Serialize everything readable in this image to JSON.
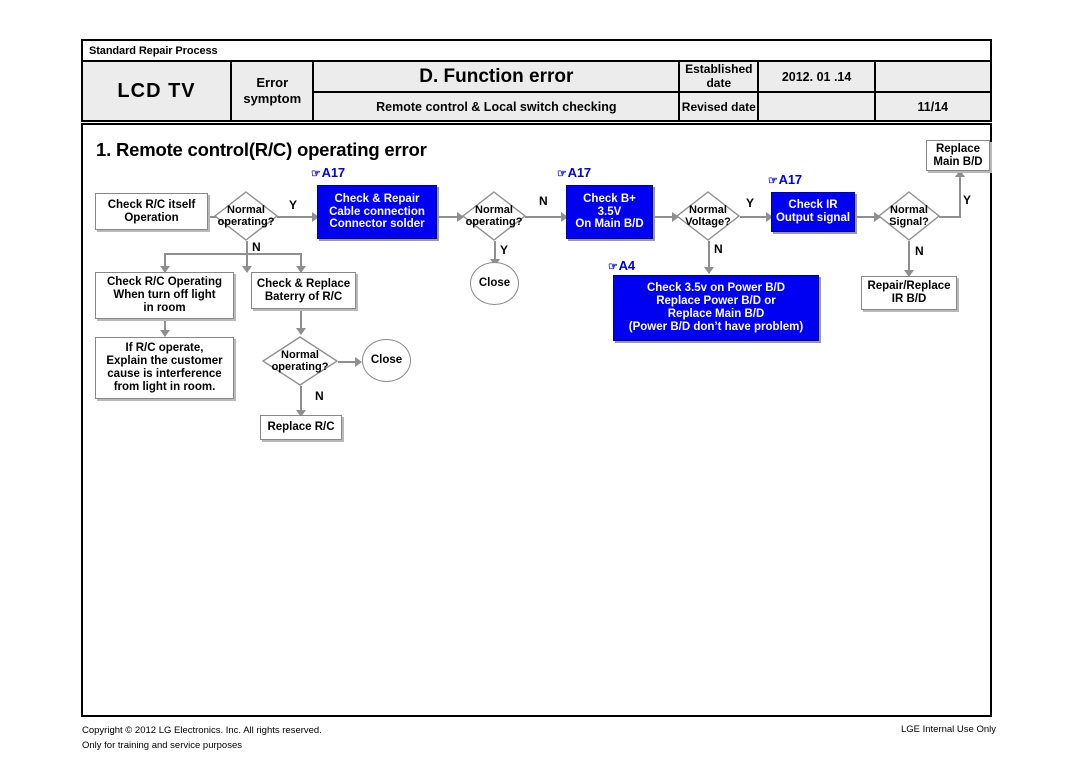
{
  "header": {
    "standard_process": "Standard Repair Process",
    "product": "LCD  TV",
    "error_symptom": "Error\nsymptom",
    "error_symptom_line1": "Error",
    "error_symptom_line2": "symptom",
    "title": "D. Function error",
    "subtitle": "Remote control & Local switch checking",
    "established_label_line1": "Established",
    "established_label_line2": "date",
    "revised_label": "Revised date",
    "established_date": "2012. 01 .14",
    "revised_date": "",
    "blank_cell": "",
    "page_number": "11/14"
  },
  "section": {
    "title": "1. Remote control(R/C) operating error"
  },
  "flow": {
    "tags": {
      "a17_1": "A17",
      "a17_2": "A17",
      "a17_3": "A17",
      "a4": "A4",
      "hand_glyph": "☞"
    },
    "nodes": {
      "check_rc_itself": "Check R/C itself\nOperation",
      "check_rc_itself_l1": "Check R/C itself",
      "check_rc_itself_l2": "Operation",
      "d_normal_operating_1_l1": "Normal",
      "d_normal_operating_1_l2": "operating?",
      "check_repair_cable_l1": "Check & Repair",
      "check_repair_cable_l2": "Cable connection",
      "check_repair_cable_l3": "Connector solder",
      "d_normal_operating_2_l1": "Normal",
      "d_normal_operating_2_l2": "operating?",
      "close_1": "Close",
      "check_bplus_l1": "Check B+",
      "check_bplus_l2": "3.5V",
      "check_bplus_l3": "On Main B/D",
      "d_normal_voltage_l1": "Normal",
      "d_normal_voltage_l2": "Voltage?",
      "check_ir_l1": "Check IR",
      "check_ir_l2": "Output signal",
      "d_normal_signal_l1": "Normal",
      "d_normal_signal_l2": "Signal?",
      "replace_main_bd_l1": "Replace",
      "replace_main_bd_l2": "Main B/D",
      "repair_replace_ir_l1": "Repair/Replace",
      "repair_replace_ir_l2": "IR B/D",
      "check_35v_power_l1": "Check 3.5v on Power B/D",
      "check_35v_power_l2": "Replace Power B/D or",
      "check_35v_power_l3": "Replace Main B/D",
      "check_35v_power_l4": "(Power B/D don’t have problem)",
      "check_rc_operating_l1": "Check R/C Operating",
      "check_rc_operating_l2": "When turn off light",
      "check_rc_operating_l3": "in room",
      "if_rc_operate_l1": "If R/C operate,",
      "if_rc_operate_l2": "Explain the customer",
      "if_rc_operate_l3": "cause is interference",
      "if_rc_operate_l4": "from light in room.",
      "check_replace_battery_l1": "Check & Replace",
      "check_replace_battery_l2": "Baterry of R/C",
      "d_normal_operating_3_l1": "Normal",
      "d_normal_operating_3_l2": "operating?",
      "close_2": "Close",
      "replace_rc": "Replace R/C"
    },
    "labels": {
      "y1": "Y",
      "n1": "N",
      "n2": "N",
      "y2": "Y",
      "y3": "Y",
      "n3": "N",
      "y4": "Y",
      "n4": "N",
      "n5": "N"
    }
  },
  "footer": {
    "copyright_line1": "Copyright © 2012 LG Electronics. Inc. All rights reserved.",
    "copyright_line2": "Only for training and service purposes",
    "internal_use": "LGE Internal Use Only"
  },
  "colors": {
    "accent_blue": "#0000f2",
    "header_fill": "#ececec",
    "line_gray": "#8f8f8f"
  }
}
